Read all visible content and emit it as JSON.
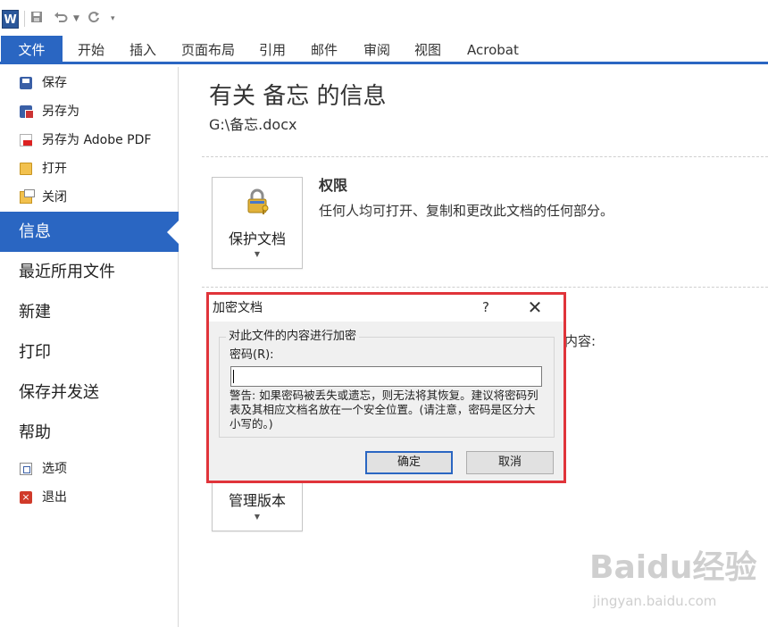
{
  "quick_access": {
    "logo": "W",
    "save_icon": "save-icon",
    "undo_icon": "undo-icon",
    "redo_icon": "redo-icon",
    "customize_icon": "dropdown-icon"
  },
  "ribbon": {
    "file_tab": "文件",
    "tabs": [
      "开始",
      "插入",
      "页面布局",
      "引用",
      "邮件",
      "审阅",
      "视图",
      "Acrobat"
    ]
  },
  "sidebar": {
    "small_items_top": [
      {
        "label": "保存",
        "icon": "save-icon"
      },
      {
        "label": "另存为",
        "icon": "save-as-icon"
      },
      {
        "label": "另存为 Adobe PDF",
        "icon": "pdf-icon"
      },
      {
        "label": "打开",
        "icon": "open-folder-icon"
      },
      {
        "label": "关闭",
        "icon": "close-folder-icon"
      }
    ],
    "big_items": [
      {
        "label": "信息",
        "active": true
      },
      {
        "label": "最近所用文件"
      },
      {
        "label": "新建"
      },
      {
        "label": "打印"
      },
      {
        "label": "保存并发送"
      },
      {
        "label": "帮助"
      }
    ],
    "small_items_bottom": [
      {
        "label": "选项",
        "icon": "options-icon"
      },
      {
        "label": "退出",
        "icon": "exit-icon"
      }
    ]
  },
  "main": {
    "title": "有关 备忘 的信息",
    "path": "G:\\备忘.docx",
    "protect_button": "保护文档",
    "permissions_title": "权限",
    "permissions_desc": "任何人均可打开、复制和更改此文档的任何部分。",
    "partial_text": "内容:",
    "manage_button": "管理版本"
  },
  "dialog": {
    "title": "加密文档",
    "help": "?",
    "close": "✕",
    "group_label": "对此文件的内容进行加密",
    "password_label": "密码(R):",
    "password_value": "",
    "warning": "警告: 如果密码被丢失或遗忘，则无法将其恢复。建议将密码列表及其相应文档名放在一个安全位置。(请注意，密码是区分大小写的。)",
    "ok": "确定",
    "cancel": "取消",
    "highlight_color": "#e0343a"
  },
  "watermark": {
    "text": "Baidu经验",
    "sub": "jingyan.baidu.com"
  },
  "colors": {
    "accent": "#2a66c2"
  }
}
